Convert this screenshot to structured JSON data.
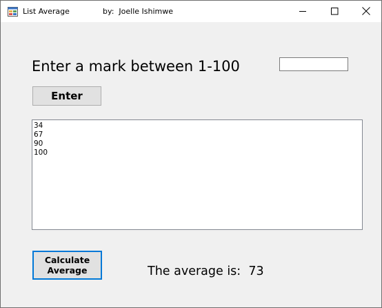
{
  "window": {
    "title": "List Average",
    "author": "by:  Joelle Ishimwe",
    "controls": {
      "minimize_icon": "minimize-icon",
      "maximize_icon": "maximize-icon",
      "close_icon": "close-icon"
    }
  },
  "form": {
    "prompt_label": "Enter a mark between 1-100",
    "mark_input_value": "",
    "enter_button_label": "Enter",
    "marks": [
      "34",
      "67",
      "90",
      "100"
    ],
    "calculate_button_line1": "Calculate",
    "calculate_button_line2": "Average",
    "result_label": "The average is:",
    "result_value": "73"
  },
  "colors": {
    "window_background": "#f0f0f0",
    "focus_border": "#0078d7",
    "button_face": "#e1e1e1"
  }
}
